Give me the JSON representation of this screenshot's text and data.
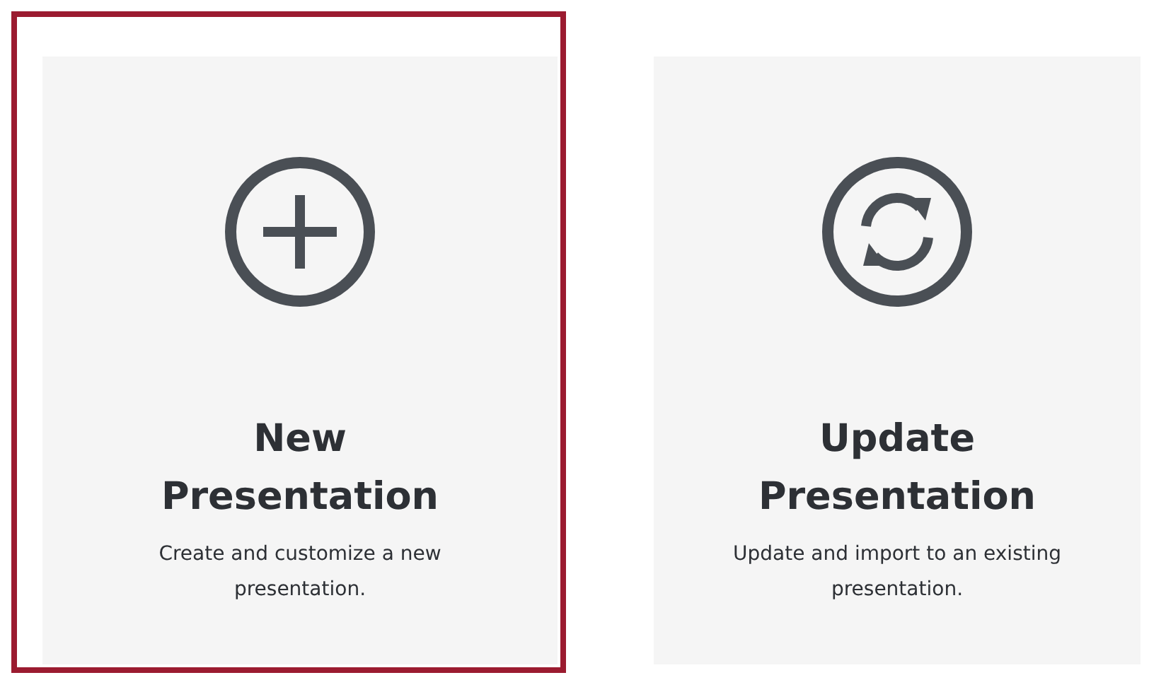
{
  "cards": [
    {
      "kind": "new",
      "title": "New Presentation",
      "description": "Create and customize a new presentation.",
      "selected": true
    },
    {
      "kind": "update",
      "title": "Update Presentation",
      "description": "Update and import to an existing presentation.",
      "selected": false
    }
  ]
}
